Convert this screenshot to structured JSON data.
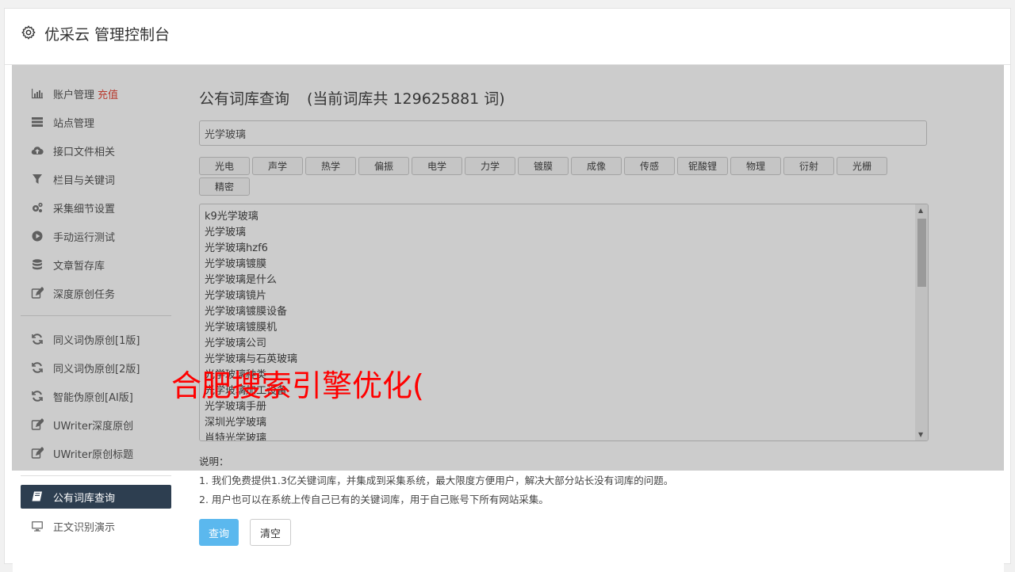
{
  "header": {
    "title": "优采云 管理控制台",
    "icon": "gear-icon"
  },
  "sidebar": {
    "group1": [
      {
        "label": "账户管理",
        "extra": "充值",
        "icon": "bar-chart-icon"
      },
      {
        "label": "站点管理",
        "icon": "server-icon"
      },
      {
        "label": "接口文件相关",
        "icon": "cloud-upload-icon"
      },
      {
        "label": "栏目与关键词",
        "icon": "filter-icon"
      },
      {
        "label": "采集细节设置",
        "icon": "gears-icon"
      },
      {
        "label": "手动运行测试",
        "icon": "play-circle-icon"
      },
      {
        "label": "文章暂存库",
        "icon": "database-icon"
      },
      {
        "label": "深度原创任务",
        "icon": "edit-icon"
      }
    ],
    "group2": [
      {
        "label": "同义词伪原创[1版]",
        "icon": "refresh-icon"
      },
      {
        "label": "同义词伪原创[2版]",
        "icon": "refresh-icon"
      },
      {
        "label": "智能伪原创[AI版]",
        "icon": "refresh-icon"
      },
      {
        "label": "UWriter深度原创",
        "icon": "edit-icon"
      },
      {
        "label": "UWriter原创标题",
        "icon": "edit-icon"
      }
    ],
    "group3": [
      {
        "label": "公有词库查询",
        "icon": "book-icon",
        "active": true
      },
      {
        "label": "正文识别演示",
        "icon": "monitor-icon"
      }
    ]
  },
  "main": {
    "title": "公有词库查询",
    "count_text": "(当前词库共 129625881 词)",
    "search_value": "光学玻璃",
    "tags": [
      "光电",
      "声学",
      "热学",
      "偏振",
      "电学",
      "力学",
      "镀膜",
      "成像",
      "传感",
      "铌酸锂",
      "物理",
      "衍射",
      "光栅",
      "精密"
    ],
    "words": [
      "k9光学玻璃",
      "光学玻璃",
      "光学玻璃hzf6",
      "光学玻璃镀膜",
      "光学玻璃是什么",
      "光学玻璃镜片",
      "光学玻璃镀膜设备",
      "光学玻璃镀膜机",
      "光学玻璃公司",
      "光学玻璃与石英玻璃",
      "光学玻璃种类",
      "光学玻璃加工设备",
      "光学玻璃手册",
      "深圳光学玻璃",
      "肖特光学玻璃"
    ],
    "notes_title": "说明：",
    "notes": [
      "1. 我们免费提供1.3亿关键词库，并集成到采集系统，最大限度方便用户，解决大部分站长没有词库的问题。",
      "2. 用户也可以在系统上传自己已有的关键词库，用于自己账号下所有网站采集。"
    ],
    "query_button": "查询",
    "clear_button": "清空"
  },
  "watermark": "合肥搜索引擎优化("
}
